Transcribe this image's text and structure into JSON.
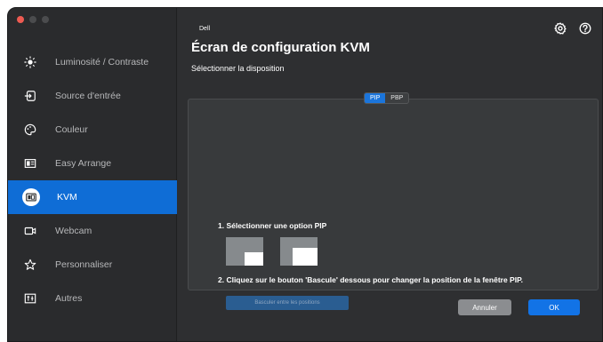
{
  "sidebar": {
    "items": [
      {
        "label": "Luminosité / Contraste",
        "icon": "brightness-icon"
      },
      {
        "label": "Source d'entrée",
        "icon": "input-source-icon"
      },
      {
        "label": "Couleur",
        "icon": "color-icon"
      },
      {
        "label": "Easy Arrange",
        "icon": "easy-arrange-icon"
      },
      {
        "label": "KVM",
        "icon": "kvm-icon",
        "active": true
      },
      {
        "label": "Webcam",
        "icon": "webcam-icon"
      },
      {
        "label": "Personnaliser",
        "icon": "star-icon"
      },
      {
        "label": "Autres",
        "icon": "others-icon"
      }
    ]
  },
  "header": {
    "brand": "Dell",
    "title": "Écran de configuration KVM",
    "subtitle": "Sélectionner la disposition",
    "icons": [
      "settings-icon",
      "help-icon"
    ]
  },
  "layout_toggle": {
    "options": [
      "PIP",
      "PBP"
    ],
    "selected": "PIP"
  },
  "panel": {
    "step1": "1. Sélectionner une option PIP",
    "step2": "2. Cliquez sur le bouton 'Bascule' dessous pour changer la position de la fenêtre PIP.",
    "swap_button": "Basculer entre les positions"
  },
  "footer": {
    "cancel": "Annuler",
    "ok": "OK"
  },
  "colors": {
    "accent": "#0f6dd6",
    "sidebar_bg": "#2a2b2d",
    "main_bg": "#2e2f31"
  }
}
